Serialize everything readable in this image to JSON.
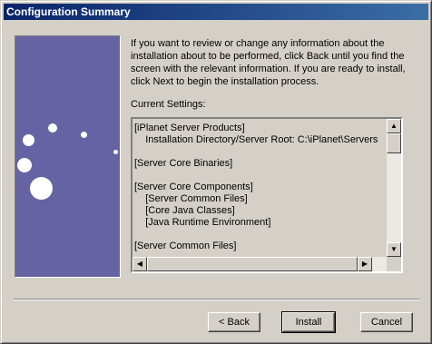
{
  "window": {
    "title": "Configuration Summary"
  },
  "description": "If you want to review or change any information about the installation about to be performed, click Back until you find the screen with the relevant information. If you are ready to install, click Next to begin the installation process.",
  "current_settings_label": "Current Settings:",
  "settings_lines": [
    "[iPlanet Server Products]",
    "    Installation Directory/Server Root: C:\\iPlanet\\Servers",
    "",
    "[Server Core Binaries]",
    "",
    "[Server Core Components]",
    "    [Server Common Files]",
    "    [Core Java Classes]",
    "    [Java Runtime Environment]",
    "",
    "[Server Common Files]"
  ],
  "buttons": {
    "back": "< Back",
    "install": "Install",
    "cancel": "Cancel"
  },
  "icons": {
    "scroll_up": "arrow-up-icon",
    "scroll_down": "arrow-down-icon",
    "scroll_left": "arrow-left-icon",
    "scroll_right": "arrow-right-icon"
  },
  "colors": {
    "title_bar": "#0a246a",
    "side_panel": "#6663a4",
    "dialog_bg": "#d4d0c8"
  }
}
